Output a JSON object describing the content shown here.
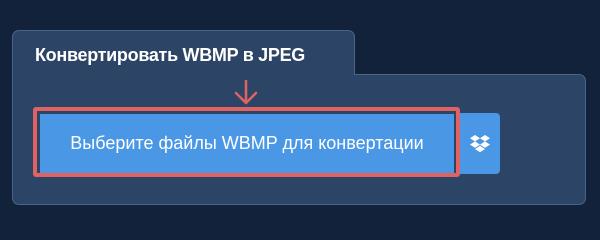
{
  "converter": {
    "title": "Конвертировать WBMP в JPEG",
    "select_button_label": "Выберите файлы WBMP для конвертации",
    "dropbox_icon": "dropbox-icon",
    "arrow_icon": "arrow-down-icon"
  },
  "colors": {
    "background": "#12223a",
    "panel": "#2c4566",
    "button": "#4a97e6",
    "highlight": "#e06262"
  }
}
